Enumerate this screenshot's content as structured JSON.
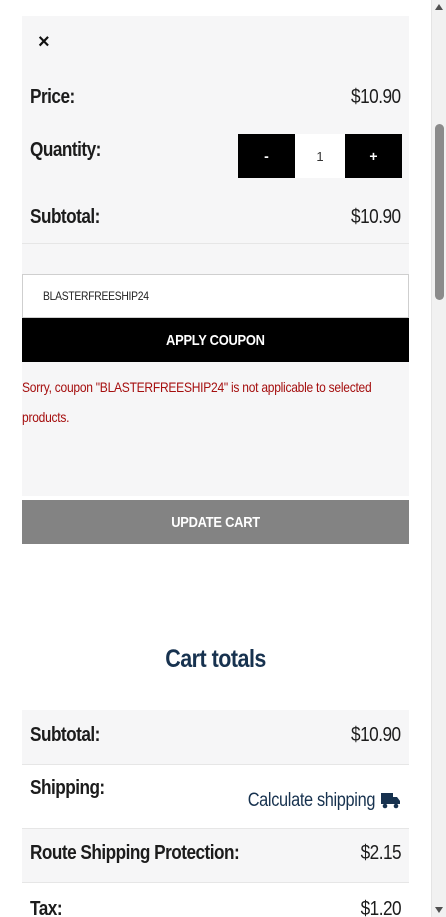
{
  "cart_item": {
    "remove_symbol": "×",
    "price_label": "Price:",
    "price_value": "$10.90",
    "quantity_label": "Quantity:",
    "quantity_minus": "-",
    "quantity_value": "1",
    "quantity_plus": "+",
    "subtotal_label": "Subtotal:",
    "subtotal_value": "$10.90"
  },
  "coupon": {
    "code_value": "BLASTERFREESHIP24",
    "apply_label": "APPLY COUPON",
    "error_message": "Sorry, coupon \"BLASTERFREESHIP24\" is not applicable to selected products."
  },
  "update_cart_label": "UPDATE CART",
  "cart_totals": {
    "title": "Cart totals",
    "subtotal_label": "Subtotal:",
    "subtotal_value": "$10.90",
    "shipping_label": "Shipping:",
    "shipping_link": "Calculate shipping",
    "shipping_icon": "truck-icon",
    "route_label": "Route Shipping Protection:",
    "route_value": "$2.15",
    "tax_label": "Tax:",
    "tax_value": "$1.20"
  },
  "colors": {
    "accent_navy": "#17324f",
    "error_red": "#a50f0f",
    "button_black": "#000000",
    "button_gray": "#838383"
  }
}
